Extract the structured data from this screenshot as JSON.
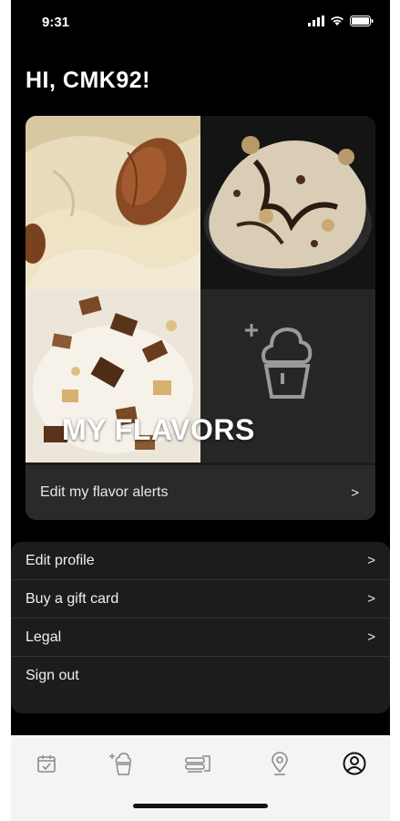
{
  "status_bar": {
    "time": "9:31"
  },
  "greeting": "HI, CMK92!",
  "flavors": {
    "title": "MY FLAVORS",
    "alerts_label": "Edit my flavor alerts",
    "chevron": ">"
  },
  "settings": {
    "items": [
      {
        "label": "Edit profile",
        "chevron": ">"
      },
      {
        "label": "Buy a gift card",
        "chevron": ">"
      },
      {
        "label": "Legal",
        "chevron": ">"
      },
      {
        "label": "Sign out"
      }
    ]
  },
  "tab_bar": {
    "tabs": [
      {
        "icon": "calendar-icon"
      },
      {
        "icon": "add-flavor-icon"
      },
      {
        "icon": "menu-sandwich-icon"
      },
      {
        "icon": "location-pin-icon"
      },
      {
        "icon": "account-icon",
        "active": true
      }
    ]
  },
  "colors": {
    "background": "#000000",
    "card": "#1c1c1c",
    "tab_bar": "#f4f4f4",
    "text": "#ffffff"
  }
}
